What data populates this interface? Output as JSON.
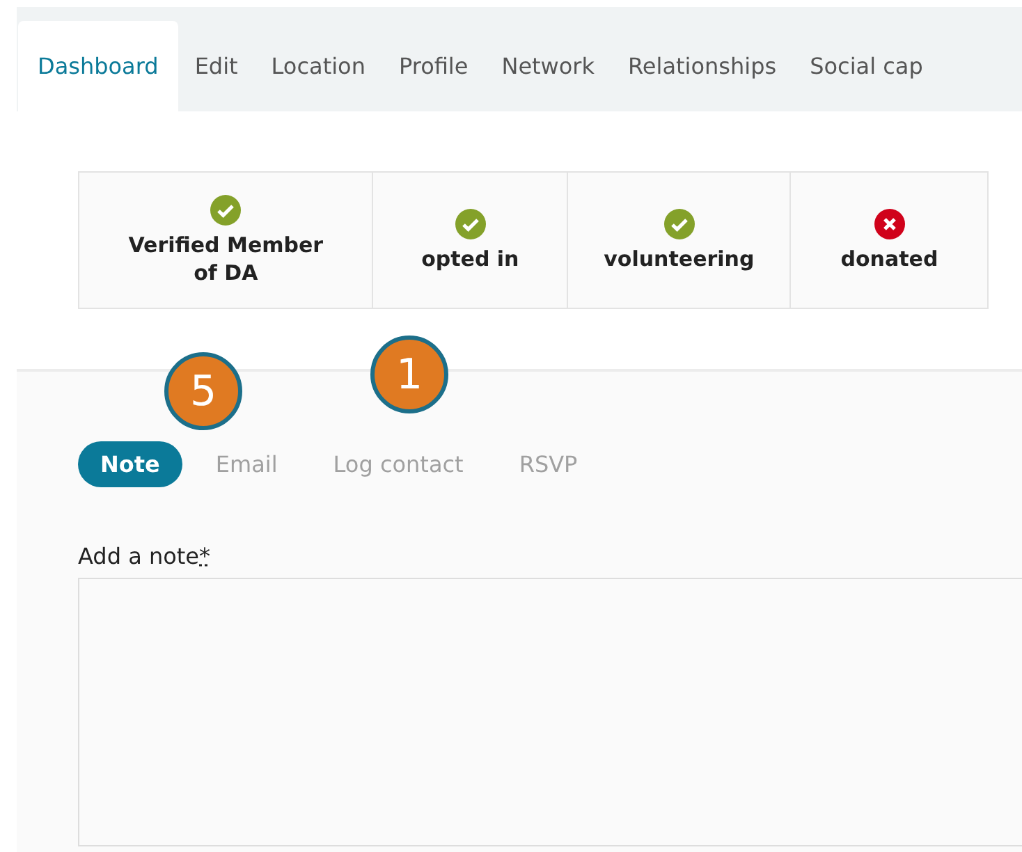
{
  "tabs": [
    {
      "label": "Dashboard",
      "selected": true
    },
    {
      "label": "Edit",
      "selected": false
    },
    {
      "label": "Location",
      "selected": false
    },
    {
      "label": "Profile",
      "selected": false
    },
    {
      "label": "Network",
      "selected": false
    },
    {
      "label": "Relationships",
      "selected": false
    },
    {
      "label": "Social cap",
      "selected": false
    }
  ],
  "statuses": [
    {
      "label": "Verified Member of DA",
      "ok": true
    },
    {
      "label": "opted in",
      "ok": true
    },
    {
      "label": "volunteering",
      "ok": true
    },
    {
      "label": "donated",
      "ok": false
    }
  ],
  "action_tabs": [
    {
      "label": "Note",
      "selected": true
    },
    {
      "label": "Email",
      "selected": false
    },
    {
      "label": "Log contact",
      "selected": false
    },
    {
      "label": "RSVP",
      "selected": false
    }
  ],
  "note_field": {
    "label": "Add a note",
    "required_mark": "*"
  },
  "callouts": [
    {
      "number": "5"
    },
    {
      "number": "1"
    }
  ]
}
